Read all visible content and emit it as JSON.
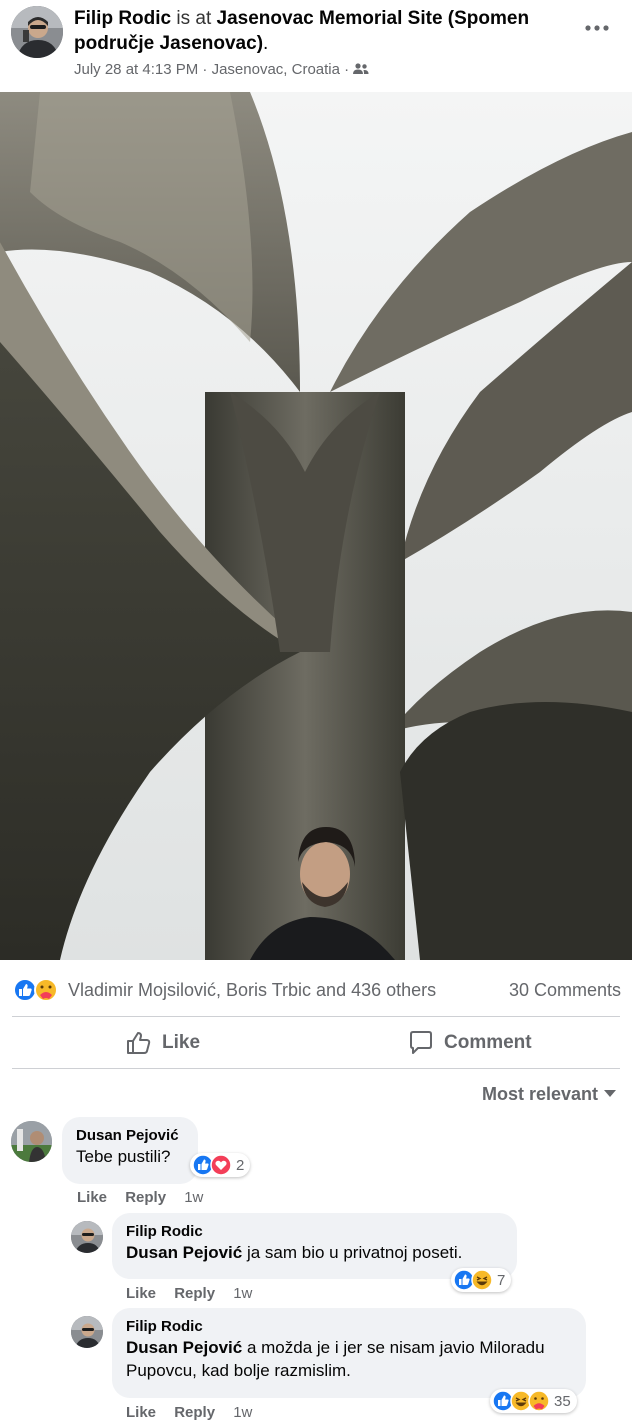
{
  "post": {
    "author": "Filip Rodic",
    "is_at": "is at",
    "place": "Jasenovac Memorial Site (Spomen područje Jasenovac)",
    "period": ".",
    "date": "July 28 at 4:13 PM",
    "separator": "·",
    "location": "Jasenovac, Croatia",
    "audience_icon": "friends-icon",
    "more_icon": "more-dots-icon"
  },
  "reactions": {
    "icons": [
      "like-reaction-icon",
      "care-reaction-icon"
    ],
    "names": "Vladimir Mojsilović, Boris Trbic and 436 others",
    "comments_count": "30 Comments"
  },
  "actions": {
    "like": "Like",
    "comment": "Comment"
  },
  "sort": {
    "label": "Most relevant"
  },
  "comments": [
    {
      "author": "Dusan Pejović",
      "text": "Tebe pustili?",
      "like": "Like",
      "reply": "Reply",
      "time": "1w",
      "reaction_count": "2",
      "reaction_icons": [
        "like-reaction-icon",
        "love-reaction-icon"
      ]
    },
    {
      "author": "Filip Rodic",
      "mention": "Dusan Pejović",
      "text": " ja sam bio u privatnoj poseti.",
      "like": "Like",
      "reply": "Reply",
      "time": "1w",
      "reaction_count": "7",
      "reaction_icons": [
        "like-reaction-icon",
        "haha-reaction-icon"
      ]
    },
    {
      "author": "Filip Rodic",
      "mention": "Dusan Pejović",
      "text": " a možda je i jer se nisam javio Miloradu Pupovcu, kad bolje razmislim.",
      "like": "Like",
      "reply": "Reply",
      "time": "1w",
      "reaction_count": "35",
      "reaction_icons": [
        "like-reaction-icon",
        "haha-reaction-icon",
        "care-reaction-icon"
      ]
    }
  ],
  "colors": {
    "like_blue": "#1877f2",
    "love_red": "#f33e58",
    "reaction_yellow": "#f7b928",
    "secondary_text": "#65676b",
    "bubble_bg": "#f0f2f5"
  }
}
